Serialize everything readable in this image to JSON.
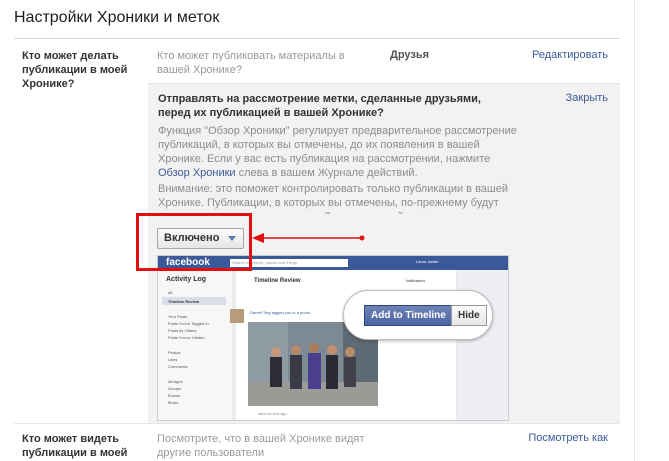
{
  "header": {
    "title": "Настройки Хроники и меток"
  },
  "rows": [
    {
      "label": "Кто может делать публикации в моей Хронике?",
      "description": "Кто может публиковать материалы в вашей Хронике?",
      "value": "Друзья",
      "action": "Редактировать"
    },
    {
      "label": "Кто может видеть публикации в моей Хронике?",
      "description": "Посмотрите, что в вашей Хронике видят другие пользователи",
      "action": "Посмотреть как"
    }
  ],
  "review_panel": {
    "heading": "Отправлять на рассмотрение метки, сделанные друзьями, перед их публикацией в вашей Хронике?",
    "close_label": "Закрыть",
    "para1_text": "Функция \"Обзор Хроники\" регулирует предварительное рассмотрение публикаций, в которых вы отмечены, до их появления в вашей Хронике. Если у вас есть публикация на рассмотрении, нажмите",
    "para1_link": "Обзор Хроники",
    "para1_after": "слева в вашем Журнале действий.",
    "para2": "Внимание: это поможет контролировать только публикации в вашей Хронике. Публикации, в которых вы отмечены, по-прежнему будут доступны в результатах поиска, Ленте новостей и других местах на Facebook.",
    "status_value": "Включено"
  },
  "preview": {
    "logo": "facebook",
    "search_placeholder": "Search for people, places and things",
    "user": "Laura Jarder",
    "sidebar_title": "Activity Log",
    "nav_items": [
      "All",
      "Timeline Review",
      "Your Posts",
      "Posts You're Tagged In",
      "Posts by Others",
      "Posts You've Hidden",
      "Photos",
      "Likes",
      "Comments",
      "All Apps",
      "Groups",
      "Events",
      "Music"
    ],
    "review_title": "Timeline Review",
    "notifications": "Notifications",
    "tagged_text": "Darrell Ting tagged you in a photo.",
    "caption": "about an hour ago",
    "add_button": "Add to Timeline",
    "hide_button": "Hide"
  },
  "colors": {
    "accent_link": "#3b5998",
    "highlight": "#e01010",
    "fb_blue": "#3b5998"
  }
}
